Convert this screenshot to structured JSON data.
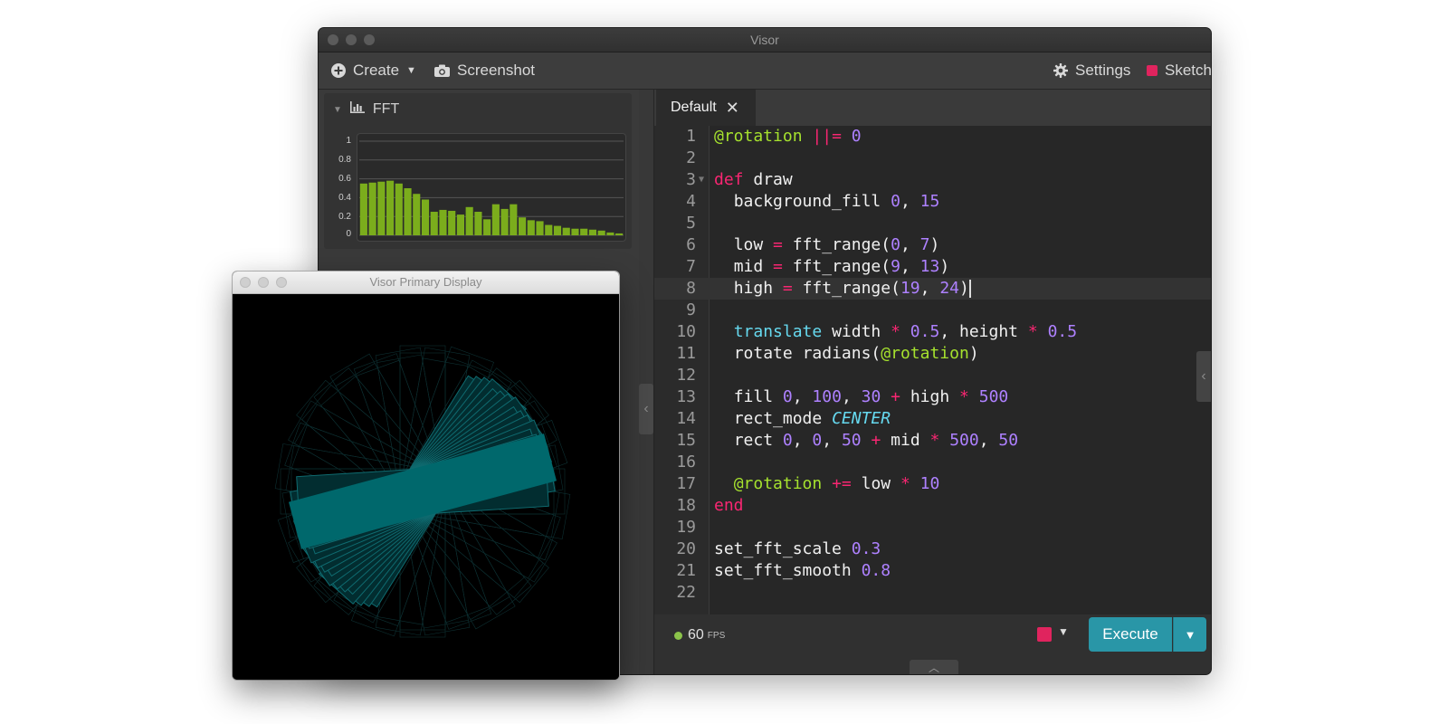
{
  "main_window": {
    "title": "Visor",
    "toolbar": {
      "create_label": "Create",
      "screenshot_label": "Screenshot",
      "settings_label": "Settings",
      "sketch_label": "Sketch"
    },
    "fft_panel": {
      "title": "FFT",
      "y_tick_labels": [
        "1",
        "0.8",
        "0.6",
        "0.4",
        "0.2",
        "0"
      ]
    },
    "editor": {
      "tab_label": "Default",
      "active_line": 8,
      "code_lines": [
        "@rotation ||= 0",
        "",
        "def draw",
        "  background_fill 0, 15",
        "",
        "  low = fft_range(0, 7)",
        "  mid = fft_range(9, 13)",
        "  high = fft_range(19, 24)",
        "",
        "  translate width * 0.5, height * 0.5",
        "  rotate radians(@rotation)",
        "",
        "  fill 0, 100, 30 + high * 500",
        "  rect_mode CENTER",
        "  rect 0, 0, 50 + mid * 500, 50",
        "",
        "  @rotation += low * 10",
        "end",
        "",
        "set_fft_scale 0.3",
        "set_fft_smooth 0.8",
        ""
      ]
    },
    "status": {
      "fps_value": "60",
      "fps_unit": "FPS",
      "execute_label": "Execute"
    }
  },
  "display_window": {
    "title": "Visor Primary Display"
  },
  "chart_data": {
    "type": "bar",
    "ylim": [
      0,
      1
    ],
    "y_ticks": [
      0,
      0.2,
      0.4,
      0.6,
      0.8,
      1
    ],
    "grid": true,
    "values": [
      0.55,
      0.56,
      0.57,
      0.58,
      0.55,
      0.5,
      0.44,
      0.38,
      0.25,
      0.27,
      0.26,
      0.22,
      0.3,
      0.25,
      0.17,
      0.33,
      0.28,
      0.33,
      0.19,
      0.16,
      0.15,
      0.11,
      0.1,
      0.08,
      0.07,
      0.07,
      0.06,
      0.05,
      0.03,
      0.02
    ]
  },
  "colors": {
    "accent": "#2996a7",
    "sketch_red": "#e0245e",
    "fft_bar_green": "#7bad1c",
    "fps_green": "#8bc34a",
    "canvas_teal": "#00686c",
    "syntax_keyword": "#f92672",
    "syntax_number": "#ae81ff",
    "syntax_ivar": "#a6e22e",
    "syntax_builtin": "#66d9ef"
  },
  "icons": {
    "create": "plus-circle-icon",
    "screenshot": "camera-icon",
    "settings": "gear-icon",
    "sketch": "square-icon",
    "fft": "bar-chart-icon",
    "tab_close": "close-icon"
  }
}
